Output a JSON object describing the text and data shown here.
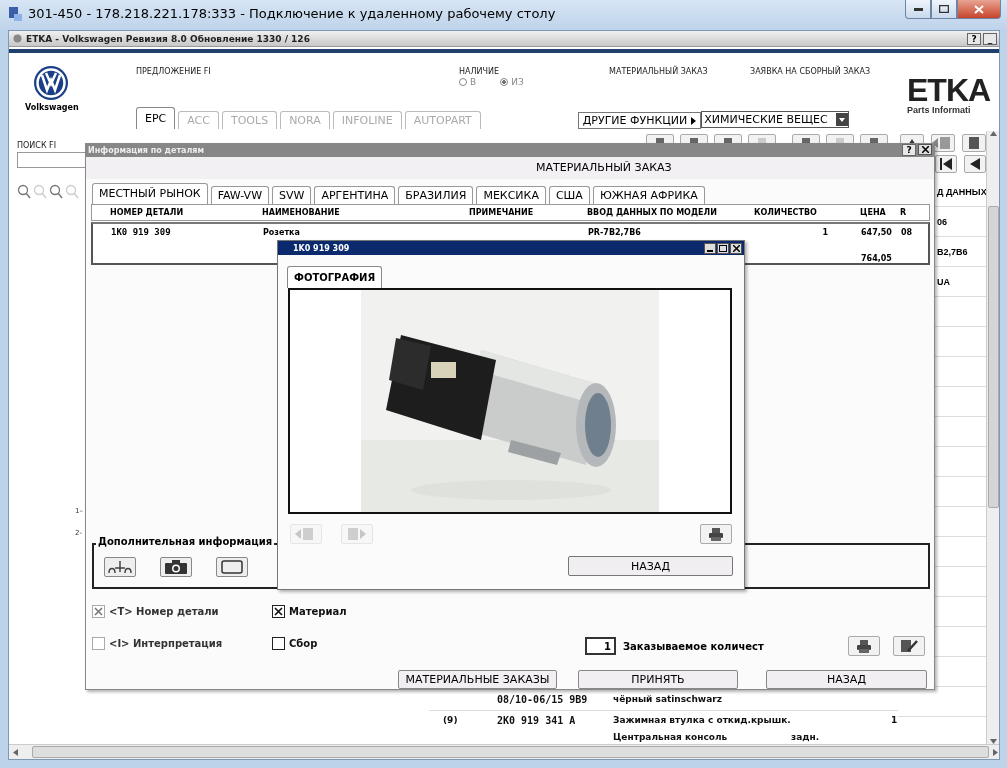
{
  "rdp_window": {
    "title": "301-450 - 178.218.221.178:333 - Подключение к удаленному рабочему столу"
  },
  "app_window": {
    "title": "ETKA - Volkswagen Ревизия 8.0 Обновление 1330 / 126",
    "help": "?",
    "minimize": "_"
  },
  "header": {
    "brand": "Volkswagen",
    "offer_label": "ПРЕДЛОЖЕНИЕ FI",
    "availability": {
      "label": "НАЛИЧИЕ",
      "options": [
        {
          "label": "В",
          "selected": false
        },
        {
          "label": "ИЗ",
          "selected": true
        }
      ]
    },
    "links": [
      "МАТЕРИАЛЬНЫЙ ЗАКАЗ",
      "ЗАЯВКА НА СБОРНЫЙ ЗАКАЗ"
    ],
    "logo": {
      "title": "ETKA",
      "subtitle": "Parts Informati"
    }
  },
  "tabs": [
    {
      "label": "EPC",
      "selected": true,
      "disabled": false
    },
    {
      "label": "ACC",
      "selected": false,
      "disabled": true
    },
    {
      "label": "TOOLS",
      "selected": false,
      "disabled": true
    },
    {
      "label": "NORA",
      "selected": false,
      "disabled": true
    },
    {
      "label": "INFOLINE",
      "selected": false,
      "disabled": true
    },
    {
      "label": "AUTOPART",
      "selected": false,
      "disabled": true
    }
  ],
  "other_functions": {
    "label": "ДРУГИЕ ФУНКЦИИ",
    "select_value": "ХИМИЧЕСКИЕ ВЕЩЕС"
  },
  "search": {
    "label": "ПОИСК FI"
  },
  "illustration_labels": [
    "1–",
    "2-"
  ],
  "right_column": [
    "Д ДАННЫХ",
    "06",
    "B2,7B6",
    "UA"
  ],
  "background_rows": [
    {
      "col_2": "08/10-06/15 9B9",
      "col_3": "чёрный satinschwarz"
    },
    {
      "col_1": "(9)",
      "col_2": "2K0 919 341 A",
      "col_3": "Зажимная втулка с откид.крышк.",
      "col_5": "1"
    },
    {
      "col_3": "Центральная консоль",
      "col_4": "задн."
    }
  ],
  "details_dialog": {
    "title": "Информация по деталям",
    "help": "?",
    "heading": "МАТЕРИАЛЬНЫЙ ЗАКАЗ",
    "tabs": [
      {
        "label": "МЕСТНЫЙ РЫНОК",
        "selected": true
      },
      {
        "label": "FAW-VW",
        "selected": false
      },
      {
        "label": "SVW",
        "selected": false
      },
      {
        "label": "АРГЕНТИНА",
        "selected": false
      },
      {
        "label": "БРАЗИЛИЯ",
        "selected": false
      },
      {
        "label": "МЕКСИКА",
        "selected": false
      },
      {
        "label": "США",
        "selected": false
      },
      {
        "label": "ЮЖНАЯ АФРИКА",
        "selected": false
      }
    ],
    "table": {
      "columns": [
        "НОМЕР ДЕТАЛИ",
        "НАИМЕНОВАНИЕ",
        "ПРИМЕЧАНИЕ",
        "ВВОД ДАННЫХ ПО МОДЕЛИ",
        "КОЛИЧЕСТВО",
        "ЦЕНА",
        "R"
      ],
      "rows": [
        {
          "part_number": "1K0 919 309",
          "name": "Розетка",
          "model": "PR-7B2,7B6",
          "quantity": "1",
          "price": "647,50",
          "r": "08",
          "price_2": "764,05"
        }
      ]
    },
    "extra_info_label": "Дополнительная информация",
    "options": [
      {
        "label": "<T> Номер детали",
        "checked": true,
        "disabled": true
      },
      {
        "label": "Материал",
        "checked": true,
        "disabled": false
      },
      {
        "label": "<I> Интерпретация",
        "checked": false,
        "disabled": true
      },
      {
        "label": "Сбор",
        "checked": false,
        "disabled": false
      }
    ],
    "order_quantity": {
      "value": "1",
      "label": "Заказываемое количест"
    },
    "buttons": [
      "МАТЕРИАЛЬНЫЕ ЗАКАЗЫ",
      "ПРИНЯТЬ",
      "НАЗАД"
    ]
  },
  "photo_window": {
    "title": "1K0 919 309",
    "tab": {
      "label": "ФОТОГРАФИЯ",
      "selected": true
    },
    "nav_disabled": true,
    "back_button": "НАЗАД"
  }
}
